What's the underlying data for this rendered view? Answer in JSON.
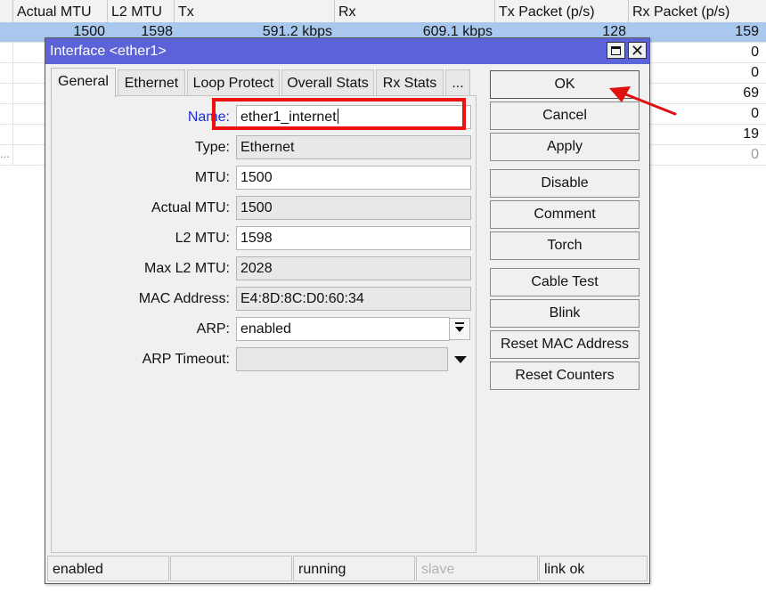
{
  "table": {
    "headers": [
      "Actual MTU",
      "L2 MTU",
      "Tx",
      "Rx",
      "Tx Packet (p/s)",
      "Rx Packet (p/s)"
    ],
    "selected_row": {
      "actual_mtu": "1500",
      "l2_mtu": "1598",
      "tx": "591.2 kbps",
      "rx": "609.1 kbps",
      "tx_packet": "128",
      "rx_packet": "159"
    },
    "rx_packet_values": [
      "0",
      "0",
      "69",
      "0",
      "19",
      "0"
    ],
    "more_indicator": "..."
  },
  "dialog": {
    "title": "Interface <ether1>",
    "close_glyph": "✕",
    "tabs": [
      "General",
      "Ethernet",
      "Loop Protect",
      "Overall Stats",
      "Rx Stats",
      "..."
    ],
    "active_tab": "General",
    "fields": {
      "name_label": "Name:",
      "name_value": "ether1_internet",
      "type_label": "Type:",
      "type_value": "Ethernet",
      "mtu_label": "MTU:",
      "mtu_value": "1500",
      "actual_mtu_label": "Actual MTU:",
      "actual_mtu_value": "1500",
      "l2_mtu_label": "L2 MTU:",
      "l2_mtu_value": "1598",
      "max_l2_mtu_label": "Max L2 MTU:",
      "max_l2_mtu_value": "2028",
      "mac_label": "MAC Address:",
      "mac_value": "E4:8D:8C:D0:60:34",
      "arp_label": "ARP:",
      "arp_value": "enabled",
      "arp_timeout_label": "ARP Timeout:",
      "arp_timeout_value": ""
    },
    "buttons": {
      "ok": "OK",
      "cancel": "Cancel",
      "apply": "Apply",
      "disable": "Disable",
      "comment": "Comment",
      "torch": "Torch",
      "cable_test": "Cable Test",
      "blink": "Blink",
      "reset_mac": "Reset MAC Address",
      "reset_counters": "Reset Counters"
    },
    "status": {
      "enabled": "enabled",
      "empty": "",
      "running": "running",
      "slave": "slave",
      "link": "link ok"
    }
  },
  "annotation": {
    "highlight_color": "#ee1111",
    "highlight_target": "name-field",
    "arrow_target": "ok-button"
  },
  "colors": {
    "titlebar": "#5c63d8",
    "selected_row": "#a9c8ee",
    "name_label": "#1c2bd6"
  }
}
